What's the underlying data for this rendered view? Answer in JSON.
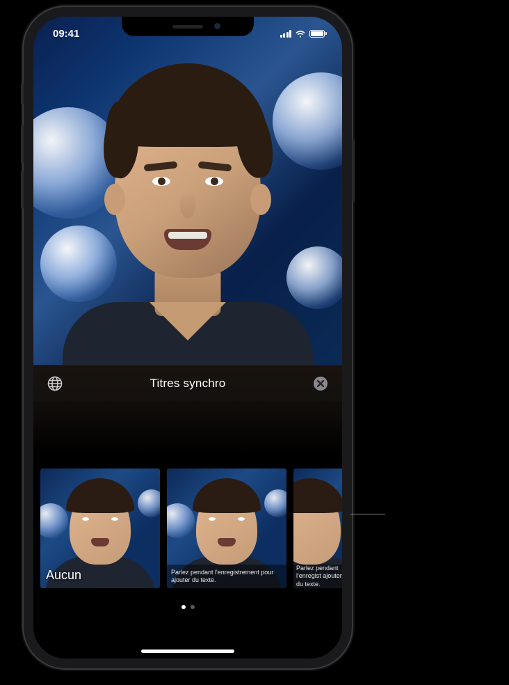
{
  "status": {
    "time": "09:41"
  },
  "panel": {
    "title": "Titres synchro",
    "globe_icon": "globe-icon",
    "close_icon": "close-icon"
  },
  "thumbnails": {
    "none_label": "Aucun",
    "caption_hint": "Parlez pendant l'enregistrement pour ajouter du texte.",
    "caption_hint_partial": "Parlez pendant l'enregist\najouter du texte."
  }
}
